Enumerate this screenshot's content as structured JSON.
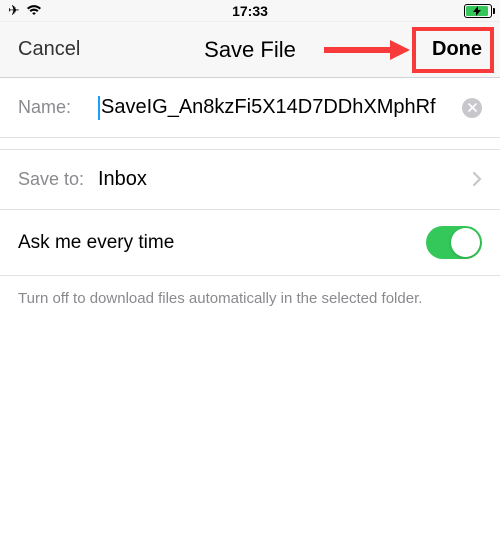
{
  "status": {
    "time": "17:33"
  },
  "nav": {
    "cancel": "Cancel",
    "title": "Save File",
    "done": "Done"
  },
  "form": {
    "name_label": "Name:",
    "name_value": "SaveIG_An8kzFi5X14D7DDhXMphRf",
    "saveTo_label": "Save to:",
    "saveTo_value": "Inbox",
    "askToggle_label": "Ask me every time",
    "description": "Turn off to download files automatically in the selected folder."
  }
}
